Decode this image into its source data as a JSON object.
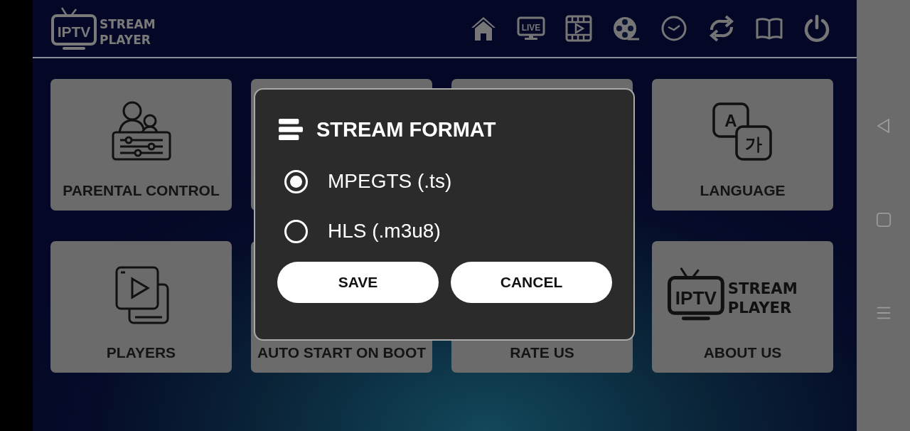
{
  "header": {
    "logo": {
      "badge": "IPTV",
      "line1": "STREAM",
      "line2": "PLAYER"
    },
    "icons": [
      {
        "kind": "home"
      },
      {
        "kind": "live",
        "text": "LIVE"
      },
      {
        "kind": "video"
      },
      {
        "kind": "reel"
      },
      {
        "kind": "clock"
      },
      {
        "kind": "refresh"
      },
      {
        "kind": "book"
      },
      {
        "kind": "power"
      }
    ]
  },
  "tiles": [
    {
      "kind": "parental",
      "label": "PARENTAL CONTROL"
    },
    {
      "kind": "covered"
    },
    {
      "kind": "covered"
    },
    {
      "kind": "language",
      "label": "LANGUAGE",
      "glyphs": [
        "A",
        "가"
      ]
    },
    {
      "kind": "players",
      "label": "PLAYERS"
    },
    {
      "kind": "covered",
      "label": "AUTO START ON BOOT"
    },
    {
      "kind": "covered",
      "label": "RATE US"
    },
    {
      "kind": "about",
      "label": "ABOUT US",
      "logo": {
        "badge": "IPTV",
        "line1": "STREAM",
        "line2": "PLAYER"
      }
    }
  ],
  "dialog": {
    "title": "STREAM FORMAT",
    "options": [
      {
        "label": "MPEGTS (.ts)",
        "selected": true
      },
      {
        "label": "HLS (.m3u8)",
        "selected": false
      }
    ],
    "buttons": [
      "SAVE",
      "CANCEL"
    ]
  },
  "nav_bar": [
    {
      "kind": "back"
    },
    {
      "kind": "home"
    },
    {
      "kind": "recents"
    }
  ]
}
